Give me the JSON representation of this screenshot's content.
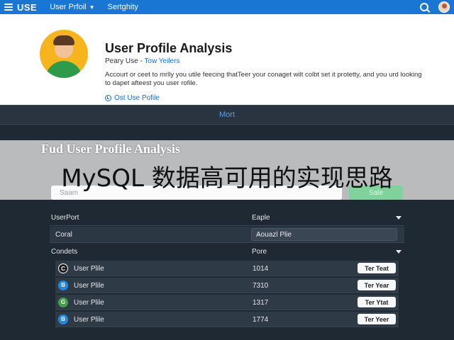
{
  "topbar": {
    "brand": "USE",
    "nav": [
      {
        "label": "User Prfoil"
      },
      {
        "label": "Sertghity"
      }
    ]
  },
  "profile": {
    "title": "User Profile Analysis",
    "sub_prefix": "Peary Use - ",
    "sub_link": "Tow Yeilers",
    "description": "Accourt or ceet to mrlly you utile feecing thatTeer your conaget wilt colbt set it protetty, and you urd looking to dapet afteest you user rofile.",
    "more_link": "Ost Use Pofile"
  },
  "more_bar": {
    "label": "Mort"
  },
  "panel": {
    "title": "Fud User Profile Analysis",
    "search_placeholder": "Saam",
    "save_label": "Sale",
    "rows": [
      {
        "col1": "UserPort",
        "col2": "Eaple"
      },
      {
        "col1": "Coral",
        "col2": "Aouazl Plie"
      },
      {
        "col1": "Condets",
        "col2": "Pore"
      }
    ],
    "users": [
      {
        "icon_letter": "C",
        "icon_color": "#1a1a1a",
        "name": "User Plile",
        "value": "1014",
        "button": "Ter Teat"
      },
      {
        "icon_letter": "B",
        "icon_color": "#1e88e5",
        "name": "User Plile",
        "value": "7310",
        "button": "Ter Year"
      },
      {
        "icon_letter": "G",
        "icon_color": "#43a047",
        "name": "User Plile",
        "value": "1317",
        "button": "Ter Ytat"
      },
      {
        "icon_letter": "B",
        "icon_color": "#1e88e5",
        "name": "User Plile",
        "value": "1774",
        "button": "Ter Yeer"
      }
    ]
  },
  "banner": {
    "text": "MySQL 数据高可用的实现思路"
  },
  "colors": {
    "topbar": "#1976d2",
    "accent_link": "#1a6fd0",
    "save_green": "#3fb569",
    "panel_bg": "#1f2933"
  }
}
